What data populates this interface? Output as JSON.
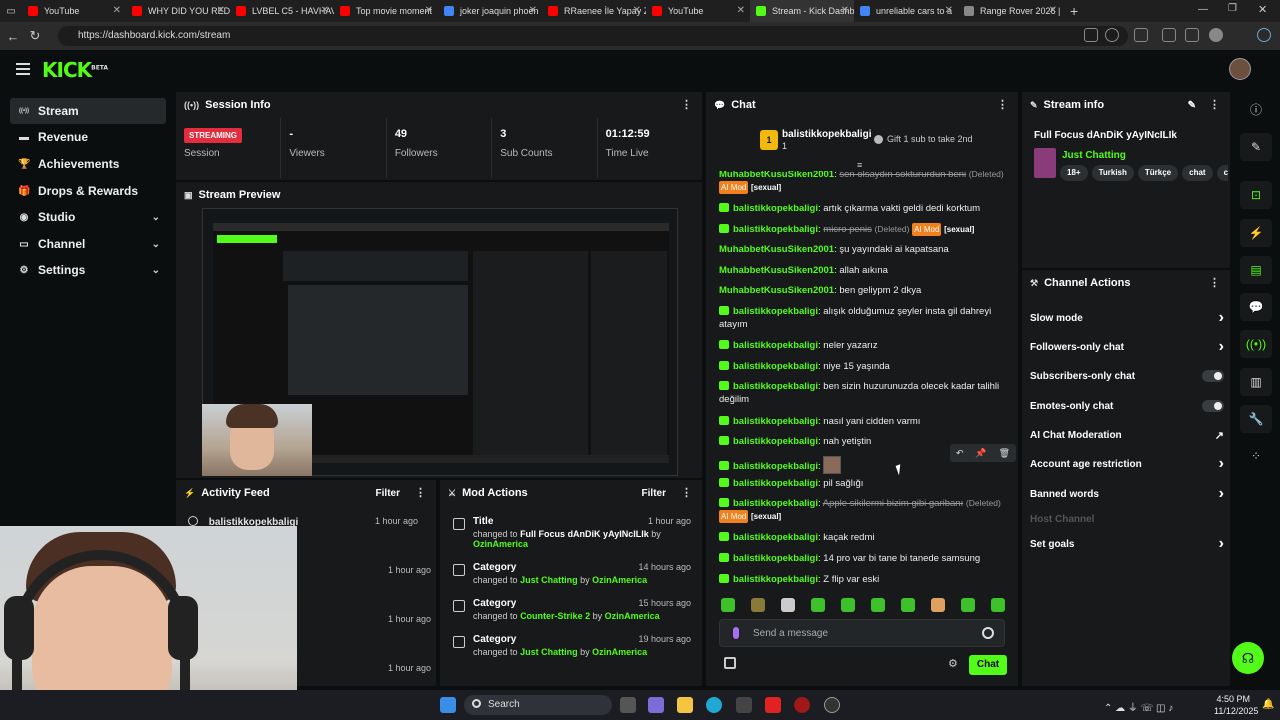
{
  "browser": {
    "tabs": [
      {
        "title": "YouTube",
        "color": "#ff0000",
        "active": false
      },
      {
        "title": "WHY DID YOU REDE",
        "color": "#ff0000",
        "active": false
      },
      {
        "title": "LVBEL C5 - HAVHAV",
        "color": "#ff0000",
        "active": false
      },
      {
        "title": "Top movie moment",
        "color": "#ff0000",
        "active": false
      },
      {
        "title": "joker joaquin phoen",
        "color": "#4285f4",
        "active": false
      },
      {
        "title": "RRaenee İle Yapay Z",
        "color": "#ff0000",
        "active": false
      },
      {
        "title": "YouTube",
        "color": "#ff0000",
        "active": false
      },
      {
        "title": "Stream - Kick Dashb",
        "color": "#53fc18",
        "active": true
      },
      {
        "title": "unreliable cars to a",
        "color": "#4285f4",
        "active": false
      },
      {
        "title": "Range Rover 2026 |",
        "color": "#888888",
        "active": false
      }
    ],
    "url": "https://dashboard.kick.com/stream"
  },
  "app": {
    "logo": "KICK",
    "logo_badge": "BETA"
  },
  "sidebar": {
    "items": [
      {
        "label": "Stream",
        "icon": "broadcast-icon",
        "active": true
      },
      {
        "label": "Revenue",
        "icon": "revenue-icon",
        "active": false
      },
      {
        "label": "Achievements",
        "icon": "trophy-icon",
        "active": false
      },
      {
        "label": "Drops & Rewards",
        "icon": "gift-icon",
        "active": false
      },
      {
        "label": "Studio",
        "icon": "studio-icon",
        "active": false,
        "expandable": true
      },
      {
        "label": "Channel",
        "icon": "channel-icon",
        "active": false,
        "expandable": true
      },
      {
        "label": "Settings",
        "icon": "gear-icon",
        "active": false,
        "expandable": true
      }
    ]
  },
  "session_info": {
    "title": "Session Info",
    "status_badge": "STREAMING",
    "status_label": "Session",
    "stats": [
      {
        "value": "-",
        "label": "Viewers"
      },
      {
        "value": "49",
        "label": "Followers"
      },
      {
        "value": "3",
        "label": "Sub Counts"
      },
      {
        "value": "01:12:59",
        "label": "Time Live"
      }
    ]
  },
  "stream_preview": {
    "title": "Stream Preview"
  },
  "activity_feed": {
    "title": "Activity Feed",
    "filter": "Filter",
    "user": "balistikkopekbaligi",
    "times": [
      "1 hour ago",
      "1 hour ago",
      "1 hour ago",
      "1 hour ago"
    ]
  },
  "mod_actions": {
    "title": "Mod Actions",
    "filter": "Filter",
    "items": [
      {
        "title": "Title",
        "changed": "changed to",
        "value": "Full Focus dAnDiK yAyINcILIk",
        "by": "by",
        "user": "OzinAmerica",
        "time": "1 hour ago"
      },
      {
        "title": "Category",
        "changed": "changed to",
        "value": "Just Chatting",
        "by": "by",
        "user": "OzinAmerica",
        "time": "14 hours ago"
      },
      {
        "title": "Category",
        "changed": "changed to",
        "value": "Counter-Strike 2",
        "by": "by",
        "user": "OzinAmerica",
        "time": "15 hours ago"
      },
      {
        "title": "Category",
        "changed": "changed to",
        "value": "Just Chatting",
        "by": "by",
        "user": "OzinAmerica",
        "time": "19 hours ago"
      }
    ]
  },
  "chat": {
    "title": "Chat",
    "top_gifter": {
      "rank": "1",
      "name": "balistikkopekbaligi",
      "count": "1",
      "gift_text": "Gift 1 sub to take 2nd"
    },
    "messages": [
      {
        "user": "MuhabbetKusuSiken2001",
        "text": "sen olsaydın soktururdun beni",
        "deleted": true,
        "deleted_label": "(Deleted)",
        "ai_mod": "AI Mod",
        "tag": "[sexual]"
      },
      {
        "user": "balistikkopekbaligi",
        "text": "artık çıkarma vakti geldi dedi korktum",
        "badge": true
      },
      {
        "user": "balistikkopekbaligi",
        "text": "micro penis",
        "badge": true,
        "deleted": true,
        "deleted_label": "(Deleted)",
        "ai_mod": "AI Mod",
        "tag": "[sexual]"
      },
      {
        "user": "MuhabbetKusuSiken2001",
        "text": "şu yayındaki ai kapatsana"
      },
      {
        "user": "MuhabbetKusuSiken2001",
        "text": "allah aıkına"
      },
      {
        "user": "MuhabbetKusuSiken2001",
        "text": "ben geliypm 2 dkya"
      },
      {
        "user": "balistikkopekbaligi",
        "text": "alışık olduğumuz şeyler insta gil dahreyi atayım",
        "badge": true
      },
      {
        "user": "balistikkopekbaligi",
        "text": "neler yazarız",
        "badge": true
      },
      {
        "user": "balistikkopekbaligi",
        "text": "niye 15 yaşında",
        "badge": true
      },
      {
        "user": "balistikkopekbaligi",
        "text": "ben sizin huzurunuzda olecek kadar talihli değilim",
        "badge": true
      },
      {
        "user": "balistikkopekbaligi",
        "text": "nasıl yani cidden varmı",
        "badge": true
      },
      {
        "user": "balistikkopekbaligi",
        "text": "nah yetiştin",
        "badge": true
      },
      {
        "user": "balistikkopekbaligi",
        "text": "",
        "badge": true,
        "emote": true
      },
      {
        "user": "balistikkopekbaligi",
        "text": "pil sağlığı",
        "badge": true
      },
      {
        "user": "balistikkopekbaligi",
        "text": "Apple sikilermi bizim gibi garibanı",
        "badge": true,
        "deleted": true,
        "deleted_label": "(Deleted)",
        "ai_mod": "AI Mod",
        "tag": "[sexual]"
      },
      {
        "user": "balistikkopekbaligi",
        "text": "kaçak redmi",
        "badge": true
      },
      {
        "user": "balistikkopekbaligi",
        "text": "14 pro var bi tane bi tanede samsung",
        "badge": true
      },
      {
        "user": "balistikkopekbaligi",
        "text": "Z flip var eski",
        "badge": true
      }
    ],
    "input_placeholder": "Send a message",
    "send_label": "Chat"
  },
  "stream_info": {
    "title": "Stream info",
    "stream_title": "Full Focus dAnDiK yAyINcILIk",
    "category": "Just Chatting",
    "tags": [
      "18+",
      "Turkish",
      "Türkçe",
      "chat",
      "c"
    ]
  },
  "channel_actions": {
    "title": "Channel Actions",
    "items": [
      {
        "label": "Slow mode",
        "control": "arrow"
      },
      {
        "label": "Followers-only chat",
        "control": "arrow"
      },
      {
        "label": "Subscribers-only chat",
        "control": "toggle"
      },
      {
        "label": "Emotes-only chat",
        "control": "toggle"
      },
      {
        "label": "AI Chat Moderation",
        "control": "external"
      },
      {
        "label": "Account age restriction",
        "control": "arrow"
      },
      {
        "label": "Banned words",
        "control": "arrow"
      },
      {
        "label": "Host Channel",
        "control": "none",
        "disabled": true
      },
      {
        "label": "Set goals",
        "control": "arrow"
      }
    ]
  },
  "taskbar": {
    "search": "Search",
    "time": "4:50 PM",
    "date": "11/12/2025"
  },
  "colors": {
    "accent": "#53fc18",
    "streaming": "#e32d3f",
    "ai_mod": "#f2811d"
  }
}
